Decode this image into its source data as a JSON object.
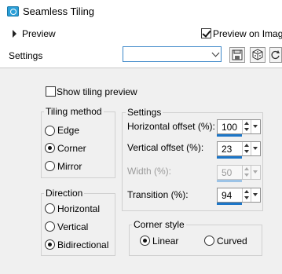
{
  "window": {
    "title": "Seamless Tiling"
  },
  "preview": {
    "label": "Preview",
    "preview_on_image_label": "Preview on Image",
    "preview_on_image_checked": true
  },
  "settings": {
    "label": "Settings",
    "preset_value": ""
  },
  "toolbar": {
    "icons": [
      "save-preset-icon",
      "randomize-icon",
      "reset-icon"
    ]
  },
  "show_tiling_preview": {
    "label": "Show tiling preview",
    "checked": false
  },
  "tiling_method": {
    "title": "Tiling method",
    "options": [
      {
        "label": "Edge",
        "selected": false
      },
      {
        "label": "Corner",
        "selected": true
      },
      {
        "label": "Mirror",
        "selected": false
      }
    ]
  },
  "direction": {
    "title": "Direction",
    "options": [
      {
        "label": "Horizontal",
        "selected": false
      },
      {
        "label": "Vertical",
        "selected": false
      },
      {
        "label": "Bidirectional",
        "selected": true
      }
    ]
  },
  "settings_group": {
    "title": "Settings",
    "fields": {
      "horizontal_offset": {
        "label": "Horizontal offset (%):",
        "value": "100",
        "enabled": true
      },
      "vertical_offset": {
        "label": "Vertical offset (%):",
        "value": "23",
        "enabled": true
      },
      "width": {
        "label": "Width (%):",
        "value": "50",
        "enabled": false
      },
      "transition": {
        "label": "Transition (%):",
        "value": "94",
        "enabled": true
      }
    }
  },
  "corner_style": {
    "title": "Corner style",
    "options": [
      {
        "label": "Linear",
        "selected": true
      },
      {
        "label": "Curved",
        "selected": false
      }
    ]
  },
  "colors": {
    "accent": "#1c76c8",
    "panel": "#f0f0f0"
  }
}
